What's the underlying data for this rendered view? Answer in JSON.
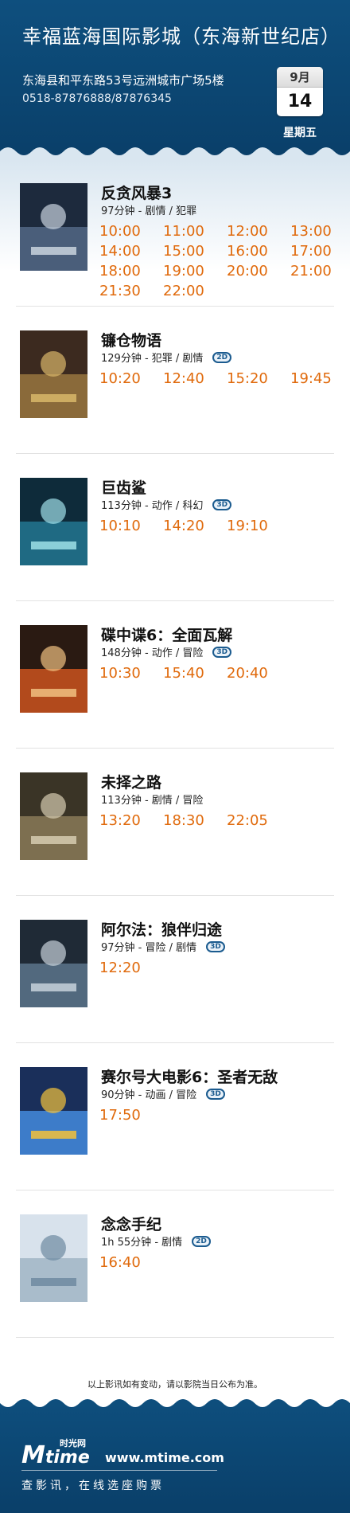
{
  "header": {
    "cinema_name": "幸福蓝海国际影城（东海新世纪店）",
    "address": "东海县和平东路53号远洲城市广场5楼",
    "phone": "0518-87876888/87876345",
    "month": "9月",
    "day": "14",
    "weekday": "星期五"
  },
  "colors": {
    "header_bg": "#0b4675",
    "showtime": "#e06a0c",
    "badge": "#1b5b8f"
  },
  "movies": [
    {
      "title": "反贪风暴3",
      "meta": "97分钟 - 剧情 / 犯罪",
      "format": "",
      "times": [
        "10:00",
        "11:00",
        "12:00",
        "13:00",
        "14:00",
        "15:00",
        "16:00",
        "17:00",
        "18:00",
        "19:00",
        "20:00",
        "21:00",
        "21:30",
        "22:00"
      ],
      "poster_icon": "poster-image"
    },
    {
      "title": "镰仓物语",
      "meta": "129分钟 - 犯罪 / 剧情",
      "format": "2D",
      "times": [
        "10:20",
        "12:40",
        "15:20",
        "19:45"
      ],
      "poster_icon": "poster-image"
    },
    {
      "title": "巨齿鲨",
      "meta": "113分钟 - 动作 / 科幻",
      "format": "3D",
      "times": [
        "10:10",
        "14:20",
        "19:10"
      ],
      "poster_icon": "poster-image"
    },
    {
      "title": "碟中谍6：全面瓦解",
      "meta": "148分钟 - 动作 / 冒险",
      "format": "3D",
      "times": [
        "10:30",
        "15:40",
        "20:40"
      ],
      "poster_icon": "poster-image"
    },
    {
      "title": "未择之路",
      "meta": "113分钟 - 剧情 / 冒险",
      "format": "",
      "times": [
        "13:20",
        "18:30",
        "22:05"
      ],
      "poster_icon": "poster-image"
    },
    {
      "title": "阿尔法：狼伴归途",
      "meta": "97分钟 - 冒险 / 剧情",
      "format": "3D",
      "times": [
        "12:20"
      ],
      "poster_icon": "poster-image"
    },
    {
      "title": "赛尔号大电影6：圣者无敌",
      "meta": "90分钟 - 动画 / 冒险",
      "format": "3D",
      "times": [
        "17:50"
      ],
      "poster_icon": "poster-image"
    },
    {
      "title": "念念手纪",
      "meta": "1h 55分钟 - 剧情",
      "format": "2D",
      "times": [
        "16:40"
      ],
      "poster_icon": "poster-image"
    }
  ],
  "notice": "以上影讯如有变动，请以影院当日公布为准。",
  "footer": {
    "logo_cn": "时光网",
    "logo_m": "M",
    "logo_time": "time",
    "site": "www.mtime.com",
    "slogan": "查影讯，在线选座购票"
  }
}
